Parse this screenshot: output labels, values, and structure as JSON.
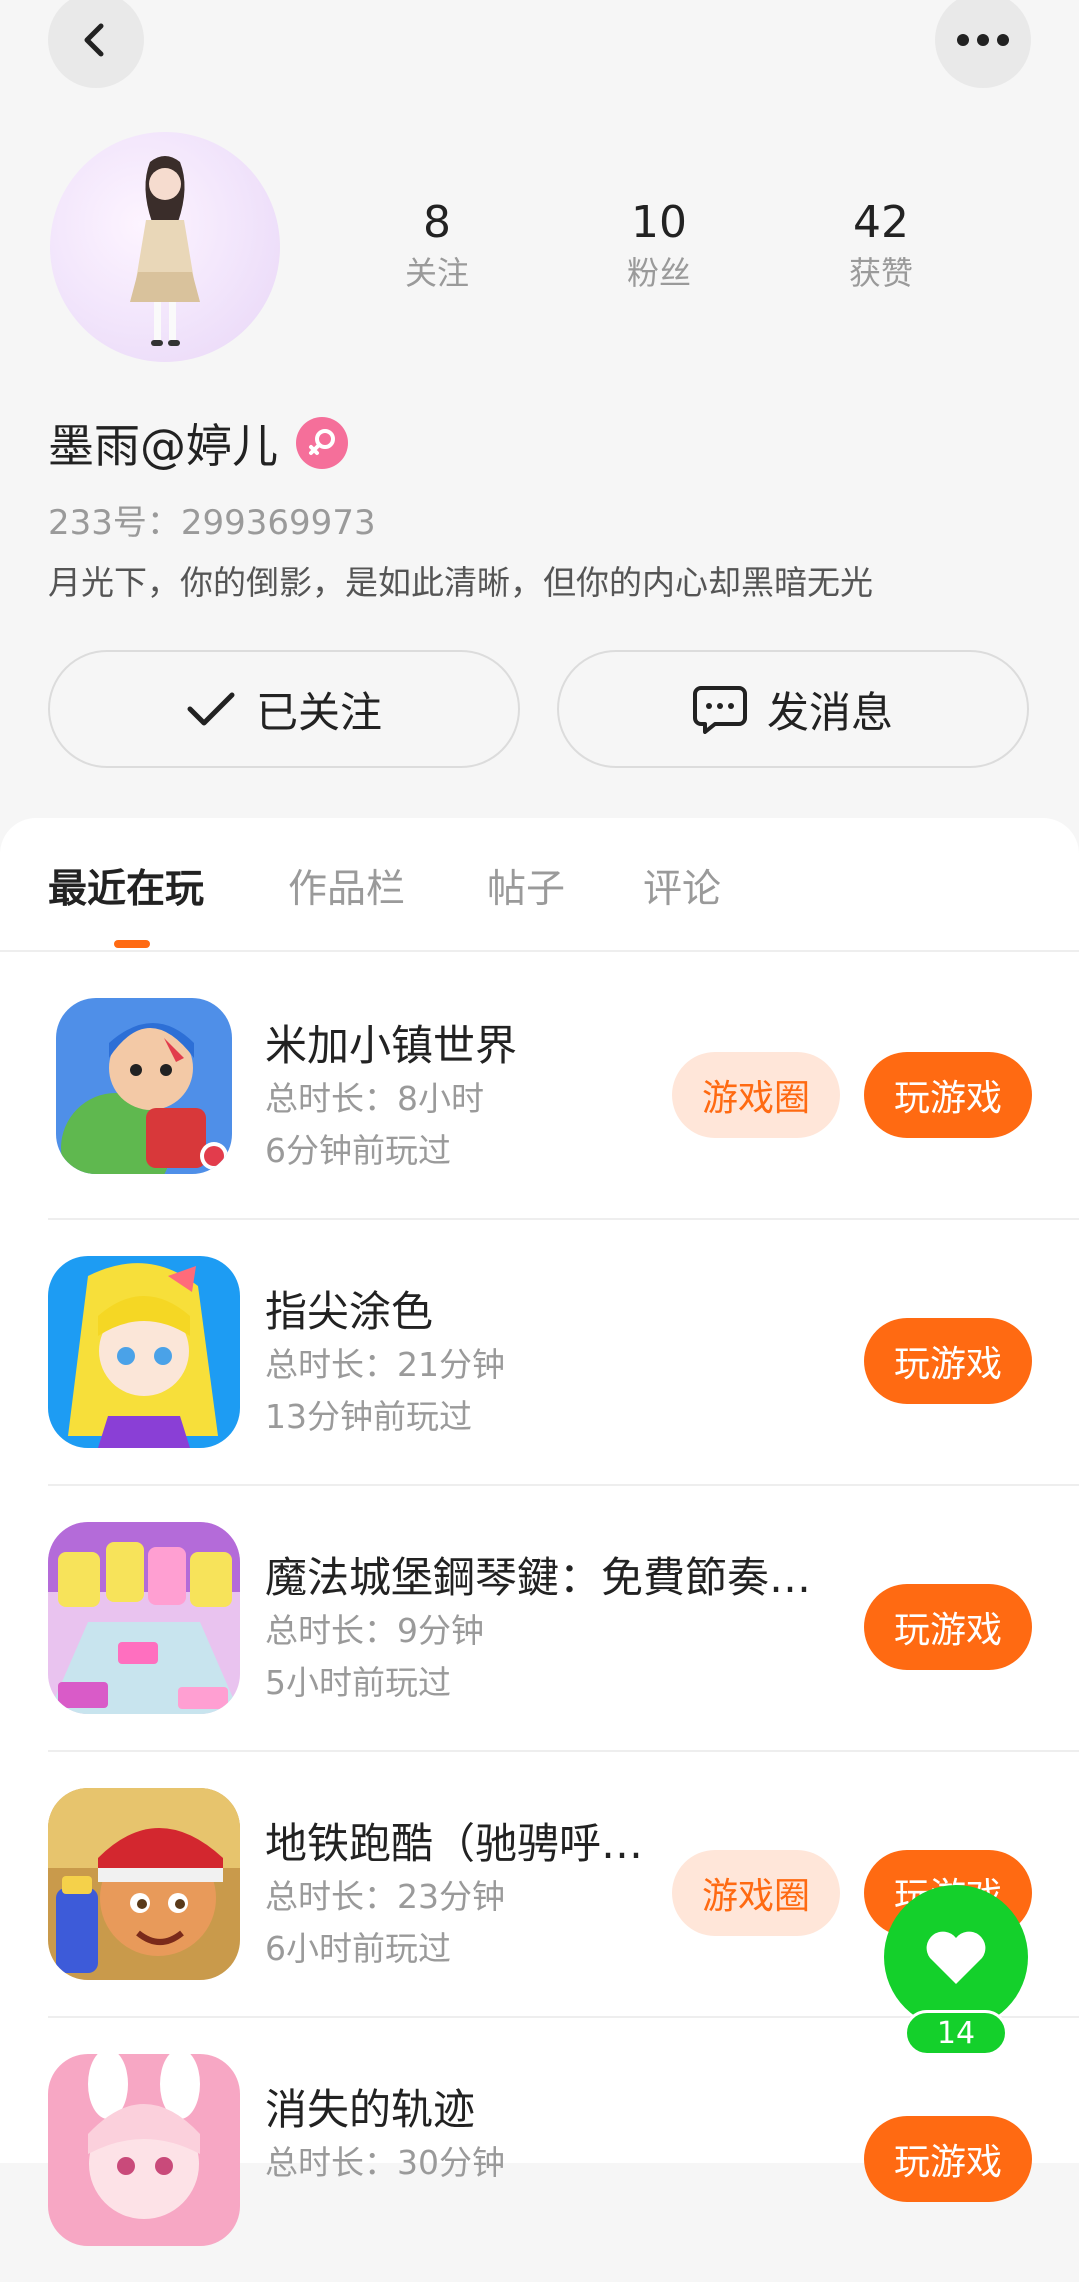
{
  "header": {
    "back_icon": "chevron-left-icon",
    "more_icon": "more-dots-icon"
  },
  "profile": {
    "stats": [
      {
        "value": "8",
        "label": "关注"
      },
      {
        "value": "10",
        "label": "粉丝"
      },
      {
        "value": "42",
        "label": "获赞"
      }
    ],
    "name": "墨雨@婷儿",
    "gender_icon": "female-icon",
    "uid": "233号：299369973",
    "bio": "月光下，你的倒影，是如此清晰，但你的内心却黑暗无光"
  },
  "actions": {
    "follow_label": "已关注",
    "message_label": "发消息"
  },
  "tabs": [
    {
      "label": "最近在玩",
      "active": true
    },
    {
      "label": "作品栏",
      "active": false
    },
    {
      "label": "帖子",
      "active": false
    },
    {
      "label": "评论",
      "active": false
    }
  ],
  "games": [
    {
      "title": "米加小镇世界",
      "duration": "总时长：8小时",
      "last_played": "6分钟前玩过",
      "circle_label": "游戏圈",
      "play_label": "玩游戏"
    },
    {
      "title": "指尖涂色",
      "duration": "总时长：21分钟",
      "last_played": "13分钟前玩过",
      "circle_label": "",
      "play_label": "玩游戏"
    },
    {
      "title": "魔法城堡鋼琴鍵：免費節奏…",
      "duration": "总时长：9分钟",
      "last_played": "5小时前玩过",
      "circle_label": "",
      "play_label": "玩游戏"
    },
    {
      "title": "地铁跑酷（驰骋呼…",
      "duration": "总时长：23分钟",
      "last_played": "6小时前玩过",
      "circle_label": "游戏圈",
      "play_label": "玩游戏"
    },
    {
      "title": "消失的轨迹",
      "duration": "总时长：30分钟",
      "last_played": "",
      "circle_label": "",
      "play_label": "玩游戏"
    }
  ],
  "favorite": {
    "icon": "heart-icon",
    "count": "14"
  },
  "colors": {
    "accent": "#ff6a12",
    "accent_light": "#ffe6d9",
    "favorite": "#14d02b",
    "gender": "#f56f9a"
  }
}
